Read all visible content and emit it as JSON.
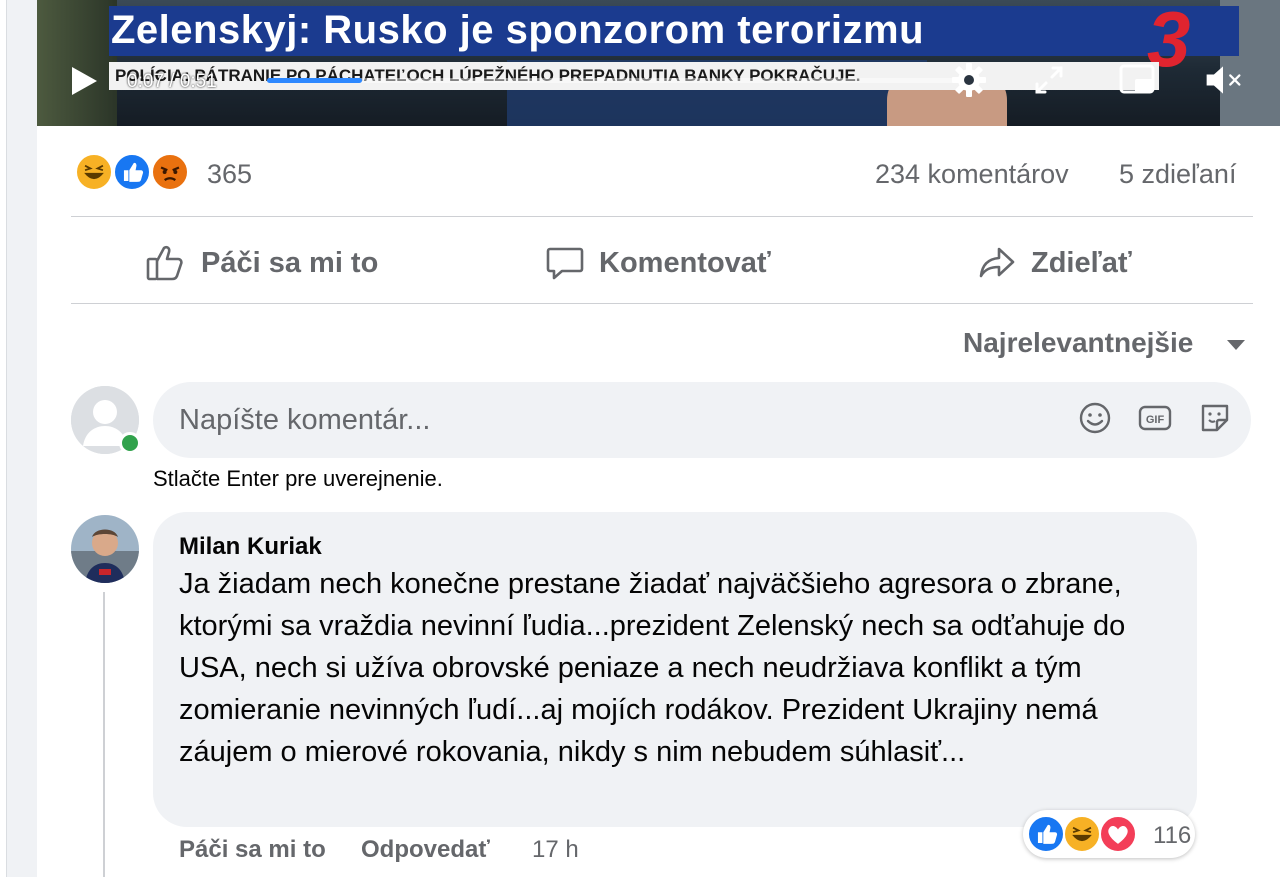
{
  "video": {
    "headline": "Zelenskyj: Rusko je sponzorom terorizmu",
    "channel_logo": "3",
    "ticker": "POLÍCIA: PÁTRANIE PO PÁCHATEĽOCH LÚPEŽNÉHO PREPADNUTIA BANKY POKRAČUJE.",
    "time": "0:07 / 0:51",
    "progress_fraction": 0.137,
    "controls": [
      "play-icon",
      "settings-gear-icon",
      "fullscreen-icon",
      "mini-player-icon",
      "muted-volume-icon"
    ]
  },
  "summary": {
    "reactions": [
      "haha",
      "like",
      "angry"
    ],
    "reaction_count": "365",
    "comments": "234 komentárov",
    "shares": "5 zdieľaní"
  },
  "actions": {
    "like": "Páči sa mi to",
    "comment": "Komentovať",
    "share": "Zdieľať"
  },
  "sort": {
    "label": "Najrelevantnejšie"
  },
  "composer": {
    "placeholder": "Napíšte komentár...",
    "hint": "Stlačte Enter pre uverejnenie.",
    "icons": [
      "emoji-icon",
      "gif-icon",
      "sticker-icon"
    ]
  },
  "comment": {
    "author": "Milan Kuriak",
    "text": "Ja žiadam nech konečne prestane žiadať najväčšieho agresora o zbrane, ktorými sa vraždia nevinní ľudia...prezident Zelenský nech sa odťahuje do USA, nech si užíva obrovské peniaze a nech neudržiava konflikt a tým zomieranie nevinných ľudí...aj mojích rodákov. Prezident Ukrajiny nemá záujem o mierové rokovania, nikdy s nim nebudem súhlasiť...",
    "reactions": [
      "like",
      "haha",
      "love"
    ],
    "reaction_count": "116",
    "like_label": "Páči sa mi to",
    "reply_label": "Odpovedať",
    "time": "17 h"
  },
  "colors": {
    "like_blue": "#1877f2",
    "haha_yellow": "#f7b125",
    "angry_orange": "#e9710f",
    "love_red": "#f33e58",
    "online_green": "#31a24c",
    "progress_blue": "#2d88ff"
  }
}
